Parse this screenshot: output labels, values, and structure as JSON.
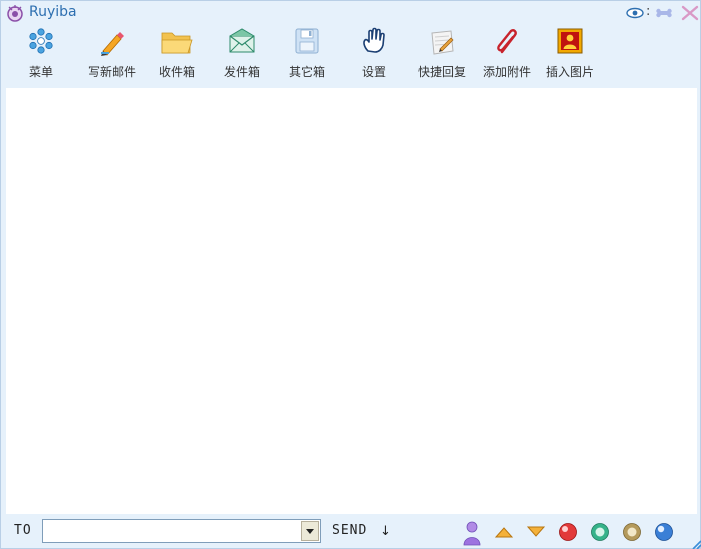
{
  "app": {
    "title": "Ruyiba"
  },
  "titlebar": {
    "separator": ":",
    "icons": [
      "eye-icon",
      "bone-icon",
      "close-icon"
    ]
  },
  "toolbar": {
    "items": [
      {
        "label": "菜单",
        "icon": "snowflake-menu-icon"
      },
      {
        "label": "写新邮件",
        "icon": "pencil-icon"
      },
      {
        "label": "收件箱",
        "icon": "folder-icon"
      },
      {
        "label": "发件箱",
        "icon": "envelope-icon"
      },
      {
        "label": "其它箱",
        "icon": "floppy-disk-icon"
      },
      {
        "label": "设置",
        "icon": "hand-icon"
      },
      {
        "label": "快捷回复",
        "icon": "quick-reply-icon"
      },
      {
        "label": "添加附件",
        "icon": "paperclip-icon"
      },
      {
        "label": "插入图片",
        "icon": "picture-icon"
      }
    ]
  },
  "bottombar": {
    "to_label": "TO",
    "to_value": "",
    "send_label": "SEND",
    "send_arrow": "↓",
    "icons": [
      "contact-icon",
      "scroll-up-icon",
      "scroll-down-icon",
      "red-ball-icon",
      "green-ball-icon",
      "gold-ball-icon",
      "blue-ball-icon"
    ]
  },
  "colors": {
    "window_bg": "#e6f1fb",
    "title_text": "#2d6fb0",
    "content_bg": "#ffffff"
  }
}
